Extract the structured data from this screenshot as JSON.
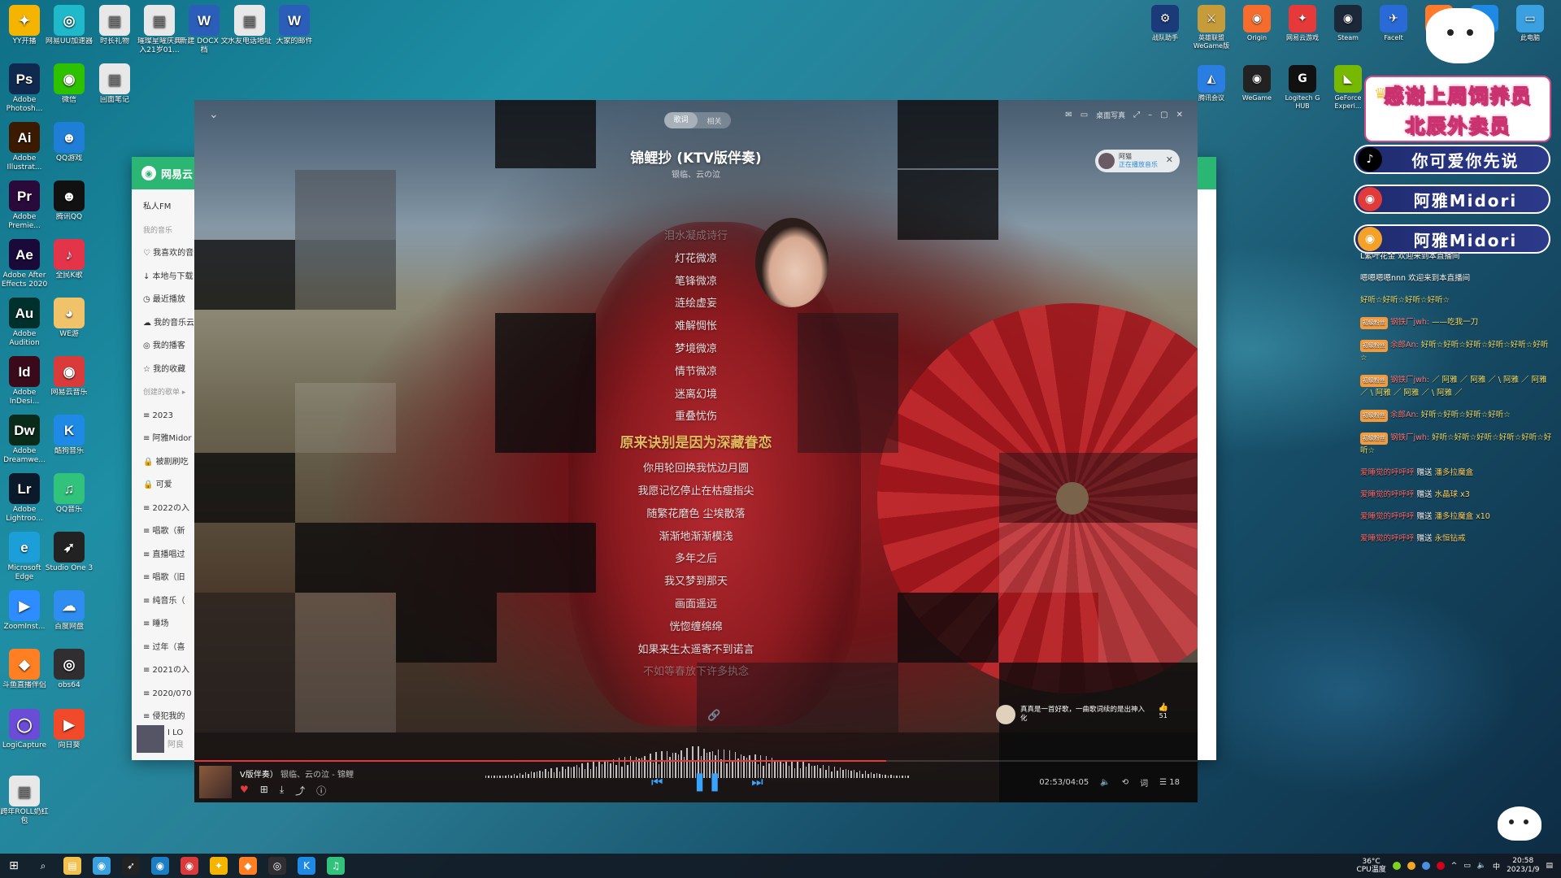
{
  "desktop_icons_left": [
    {
      "label": "YY开播",
      "icon": "yy-icon",
      "glyph": "✦",
      "color": "#f4b400"
    },
    {
      "label": "网易UU加速器",
      "icon": "uu-accelerator-icon",
      "glyph": "◎",
      "color": "#1fb9c9"
    },
    {
      "label": "时长礼物",
      "icon": "document-icon",
      "glyph": "▤",
      "color": "#e8e8e8"
    },
    {
      "label": "璀璨星曜庆典入21岁01...",
      "icon": "document-icon",
      "glyph": "▤",
      "color": "#e8e8e8"
    },
    {
      "label": "新建 DOCX 文档",
      "icon": "word-doc-icon",
      "glyph": "W",
      "color": "#2b5eb8"
    },
    {
      "label": "水友电话地址",
      "icon": "document-icon",
      "glyph": "▤",
      "color": "#e8e8e8"
    },
    {
      "label": "大家的邮件",
      "icon": "word-doc-icon",
      "glyph": "W",
      "color": "#2b5eb8"
    },
    {
      "label": "Adobe Photosh...",
      "icon": "photoshop-icon",
      "glyph": "Ps",
      "color": "#0f2a4e"
    },
    {
      "label": "微信",
      "icon": "wechat-icon",
      "glyph": "◉",
      "color": "#2dc100"
    },
    {
      "label": "回面笔记",
      "icon": "document-icon",
      "glyph": "▤",
      "color": "#e8e8e8"
    },
    {
      "label": "Adobe Illustrat...",
      "icon": "illustrator-icon",
      "glyph": "Ai",
      "color": "#3a1a00"
    },
    {
      "label": "QQ游戏",
      "icon": "qq-game-icon",
      "glyph": "☻",
      "color": "#1f7ed6"
    },
    {
      "label": "Adobe Premie...",
      "icon": "premiere-icon",
      "glyph": "Pr",
      "color": "#2a0a3a"
    },
    {
      "label": "腾讯QQ",
      "icon": "qq-icon",
      "glyph": "☻",
      "color": "#111"
    },
    {
      "label": "Adobe After Effects 2020",
      "icon": "after-effects-icon",
      "glyph": "Ae",
      "color": "#1a0a3a"
    },
    {
      "label": "全民K歌",
      "icon": "kge-icon",
      "glyph": "♪",
      "color": "#e3344a"
    },
    {
      "label": "Adobe Audition",
      "icon": "audition-icon",
      "glyph": "Au",
      "color": "#00302b"
    },
    {
      "label": "WE游",
      "icon": "we-game-icon",
      "glyph": "◕",
      "color": "#f0c36a"
    },
    {
      "label": "Adobe InDesi...",
      "icon": "indesign-icon",
      "glyph": "Id",
      "color": "#3a0a1a"
    },
    {
      "label": "网易云音乐",
      "icon": "netease-music-icon",
      "glyph": "◉",
      "color": "#d93b3b"
    },
    {
      "label": "Adobe Dreamwe...",
      "icon": "dreamweaver-icon",
      "glyph": "Dw",
      "color": "#0a2a1a"
    },
    {
      "label": "酷狗音乐",
      "icon": "kugou-icon",
      "glyph": "K",
      "color": "#1e8ae6"
    },
    {
      "label": "Adobe Lightroo...",
      "icon": "lightroom-icon",
      "glyph": "Lr",
      "color": "#0a1a2a"
    },
    {
      "label": "QQ音乐",
      "icon": "qq-music-icon",
      "glyph": "♫",
      "color": "#31c27c"
    },
    {
      "label": "Microsoft Edge",
      "icon": "edge-icon",
      "glyph": "e",
      "color": "#1c9fd8"
    },
    {
      "label": "Studio One 3",
      "icon": "studio-one-icon",
      "glyph": "➶",
      "color": "#222"
    },
    {
      "label": "ZoomInst...",
      "icon": "zoom-icon",
      "glyph": "▶",
      "color": "#2d8cff"
    },
    {
      "label": "百度网盘",
      "icon": "baidu-pan-icon",
      "glyph": "☁",
      "color": "#2f8cf0"
    },
    {
      "label": "斗鱼直播伴侣",
      "icon": "douyu-icon",
      "glyph": "◆",
      "color": "#ff7f22"
    },
    {
      "label": "obs64",
      "icon": "obs-icon",
      "glyph": "◎",
      "color": "#302e31"
    },
    {
      "label": "LogiCapture",
      "icon": "logicapture-icon",
      "glyph": "◯",
      "color": "#6b4cd6"
    },
    {
      "label": "向日葵",
      "icon": "sunflower-icon",
      "glyph": "▶",
      "color": "#f04a2a"
    },
    {
      "label": "跨年ROLL奶红包",
      "icon": "document-icon",
      "glyph": "▤",
      "color": "#e8e8e8"
    }
  ],
  "desktop_icons_right": [
    {
      "label": "战队助手",
      "icon": "gear-icon",
      "glyph": "⚙",
      "color": "#1b3a7a"
    },
    {
      "label": "英雄联盟WeGame版",
      "icon": "lol-icon",
      "glyph": "⚔",
      "color": "#c69c3a"
    },
    {
      "label": "Origin",
      "icon": "origin-icon",
      "glyph": "◉",
      "color": "#f56c2d"
    },
    {
      "label": "网易云游戏",
      "icon": "netease-cloud-game-icon",
      "glyph": "✦",
      "color": "#e63a3a"
    },
    {
      "label": "Steam",
      "icon": "steam-icon",
      "glyph": "◉",
      "color": "#1b2838"
    },
    {
      "label": "FaceIt",
      "icon": "faceit-icon",
      "glyph": "✈",
      "color": "#2a6ad6"
    },
    {
      "label": "网易大神",
      "icon": "app-icon",
      "glyph": "◈",
      "color": "#ff7a2a"
    },
    {
      "label": "加速器",
      "icon": "app-icon",
      "glyph": "✈",
      "color": "#1e8ae6"
    },
    {
      "label": "此电脑",
      "icon": "computer-icon",
      "glyph": "▭",
      "color": "#3aa0e0"
    },
    {
      "label": "腾讯会议",
      "icon": "meeting-icon",
      "glyph": "◭",
      "color": "#2a7de1"
    },
    {
      "label": "WeGame",
      "icon": "wegame-icon",
      "glyph": "◉",
      "color": "#222"
    },
    {
      "label": "Logitech G HUB",
      "icon": "logitech-icon",
      "glyph": "G",
      "color": "#111"
    },
    {
      "label": "GeForce Experi...",
      "icon": "nvidia-icon",
      "glyph": "◣",
      "color": "#76b900"
    }
  ],
  "background_window": {
    "app": "网易云",
    "sidebar": [
      {
        "label": "私人FM",
        "section": false
      },
      {
        "label": "我的音乐",
        "section": true
      },
      {
        "label": "♡ 我喜欢的音",
        "section": false
      },
      {
        "label": "↓ 本地与下载",
        "section": false
      },
      {
        "label": "◷ 最近播放",
        "section": false
      },
      {
        "label": "☁ 我的音乐云",
        "section": false
      },
      {
        "label": "◎ 我的播客",
        "section": false
      },
      {
        "label": "☆ 我的收藏",
        "section": false
      },
      {
        "label": "创建的歌单 ▸",
        "section": true
      },
      {
        "label": "≡ 2023",
        "section": false
      },
      {
        "label": "≡ 阿雅Midor",
        "section": false
      },
      {
        "label": "🔒 被剧刷吃",
        "section": false
      },
      {
        "label": "🔒 可爱",
        "section": false
      },
      {
        "label": "≡ 2022の入",
        "section": false
      },
      {
        "label": "≡ 唱歌（新",
        "section": false
      },
      {
        "label": "≡ 直播唱过",
        "section": false
      },
      {
        "label": "≡ 唱歌（旧",
        "section": false
      },
      {
        "label": "≡ 纯音乐（",
        "section": false
      },
      {
        "label": "≡ 睡场",
        "section": false
      },
      {
        "label": "≡ 过年（喜",
        "section": false
      },
      {
        "label": "≡ 2021の入",
        "section": false
      },
      {
        "label": "≡ 2020/070",
        "section": false
      },
      {
        "label": "≡ 侵犯我的",
        "section": false
      }
    ],
    "now_playing": "I LO",
    "now_playing_sub": "阿良"
  },
  "player": {
    "tabs": [
      "歌词",
      "相关"
    ],
    "active_tab": 0,
    "window_controls": {
      "desk_lyric": "桌面写真"
    },
    "song_title": "锦鲤抄 (KTV版伴奏)",
    "song_artist": "银临、云の泣",
    "friend_pill": {
      "line1": "阿猫",
      "line2": "正在播放音乐"
    },
    "lyrics": [
      {
        "text": "泪水凝成诗行",
        "state": "fade"
      },
      {
        "text": "灯花微凉",
        "state": "normal"
      },
      {
        "text": "笔锋微凉",
        "state": "normal"
      },
      {
        "text": "涟绘虚妄",
        "state": "normal"
      },
      {
        "text": "难解惆怅",
        "state": "normal"
      },
      {
        "text": "梦境微凉",
        "state": "normal"
      },
      {
        "text": "情节微凉",
        "state": "normal"
      },
      {
        "text": "迷离幻境",
        "state": "normal"
      },
      {
        "text": "重叠忧伤",
        "state": "normal"
      },
      {
        "text": "原来诀别是因为深藏眷恋",
        "state": "current"
      },
      {
        "text": "你用轮回换我忧边月圆",
        "state": "normal"
      },
      {
        "text": "我愿记忆停止在枯瘦指尖",
        "state": "normal"
      },
      {
        "text": "随繁花磨色 尘埃散落",
        "state": "normal"
      },
      {
        "text": "渐渐地渐渐模浅",
        "state": "normal"
      },
      {
        "text": "多年之后",
        "state": "normal"
      },
      {
        "text": "我又梦到那天",
        "state": "normal"
      },
      {
        "text": "画面遥远",
        "state": "normal"
      },
      {
        "text": "恍惚缠绵绵",
        "state": "normal"
      },
      {
        "text": "如果来生太遥寄不到诺言",
        "state": "normal"
      },
      {
        "text": "不如等春放下许多执念",
        "state": "fade"
      }
    ],
    "comment": {
      "text": "真真是一首好歌，一曲歌词续的是出神入化",
      "likes": "51"
    },
    "progress": 0.6897,
    "bottom": {
      "title": "V版伴奏）",
      "artist": "银临、云の泣 - 锦鲤",
      "time": "02:53/04:05",
      "playlist_count": "18"
    }
  },
  "stream_overlay": {
    "thanks_line1": "感谢上周饲养员",
    "thanks_line2": "北辰外卖员",
    "socials": [
      {
        "platform": "douyin",
        "icon": "douyin-icon",
        "glyph": "♪",
        "badge_color": "#000",
        "name": "你可爱你先说"
      },
      {
        "platform": "netease",
        "icon": "netease-music-icon",
        "glyph": "◉",
        "badge_color": "#e03a3a",
        "name": "阿雅Midori"
      },
      {
        "platform": "weibo",
        "icon": "weibo-icon",
        "glyph": "◉",
        "badge_color": "#f4a12a",
        "name": "阿雅Midori"
      }
    ],
    "chat": [
      {
        "kind": "sys",
        "text": "L紫叶花金 欢迎来到本直播间"
      },
      {
        "kind": "sys",
        "text": "嗯嗯嗯嗯nnn 欢迎来到本直播间"
      },
      {
        "kind": "msg",
        "text": "好听☆好听☆好听☆好听☆"
      },
      {
        "kind": "msg",
        "tag": "初级粉丝",
        "user": "钢铁厂jwh:",
        "text": "——吃我一刀"
      },
      {
        "kind": "msg",
        "tag": "初级粉丝",
        "user": "余郎An:",
        "text": "好听☆好听☆好听☆好听☆好听☆好听☆"
      },
      {
        "kind": "msg",
        "tag": "初级粉丝",
        "user": "钢铁厂jwh:",
        "text": "／ 阿雅 ／ 阿雅 ／ \\ 阿雅 ／ 阿雅 ／ \\ 阿雅 ／ 阿雅 ／ \\ 阿雅 ／"
      },
      {
        "kind": "msg",
        "tag": "初级粉丝",
        "user": "余郎An:",
        "text": "好听☆好听☆好听☆好听☆"
      },
      {
        "kind": "msg",
        "tag": "初级粉丝",
        "user": "钢铁厂jwh:",
        "text": "好听☆好听☆好听☆好听☆好听☆好听☆"
      },
      {
        "kind": "gift",
        "user": "爱睡觉的呼呼呼",
        "text": "赠送",
        "gift": "潘多拉魔盒"
      },
      {
        "kind": "gift",
        "user": "爱睡觉的呼呼呼",
        "text": "赠送",
        "gift": "水晶球 x3"
      },
      {
        "kind": "gift",
        "user": "爱睡觉的呼呼呼",
        "text": "赠送",
        "gift": "潘多拉魔盒 x10"
      },
      {
        "kind": "gift",
        "user": "爱睡觉的呼呼呼",
        "text": "赠送",
        "gift": "永恒钻戒"
      }
    ]
  },
  "taskbar": {
    "apps": [
      {
        "icon": "search-icon",
        "glyph": "⌕",
        "color": "transparent"
      },
      {
        "icon": "file-explorer-icon",
        "glyph": "▤",
        "color": "#f2c14e"
      },
      {
        "icon": "browser-icon",
        "glyph": "◉",
        "color": "#3aa0e0"
      },
      {
        "icon": "studio-one-icon",
        "glyph": "➶",
        "color": "#222"
      },
      {
        "icon": "wegame-icon",
        "glyph": "◉",
        "color": "#1b7ec2"
      },
      {
        "icon": "netease-music-icon",
        "glyph": "◉",
        "color": "#d93b3b"
      },
      {
        "icon": "yy-icon",
        "glyph": "✦",
        "color": "#f4b400"
      },
      {
        "icon": "douyu-icon",
        "glyph": "◆",
        "color": "#ff7f22"
      },
      {
        "icon": "obs-icon",
        "glyph": "◎",
        "color": "#302e31"
      },
      {
        "icon": "kugou-icon",
        "glyph": "K",
        "color": "#1e8ae6"
      },
      {
        "icon": "qq-music-icon",
        "glyph": "♫",
        "color": "#31c27c"
      }
    ],
    "temp_line1": "36°C",
    "temp_line2": "CPU温度",
    "time": "20:58",
    "date": "2023/1/9",
    "ime": "中"
  }
}
